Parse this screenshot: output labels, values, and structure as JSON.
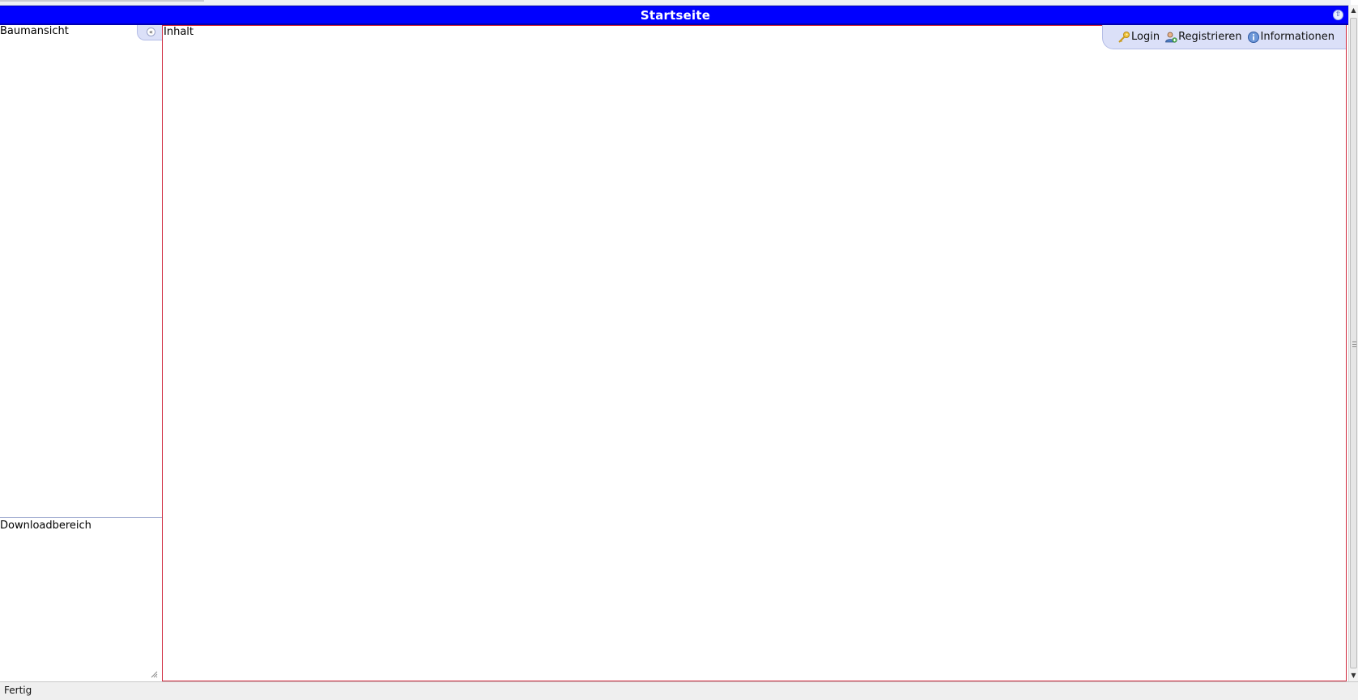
{
  "window": {
    "title": "Startseite"
  },
  "sidebar": {
    "tree_label": "Baumansicht",
    "download_label": "Downloadbereich"
  },
  "content": {
    "label": "Inhalt"
  },
  "toolbar": {
    "items": [
      {
        "label": "Login",
        "icon": "key-icon"
      },
      {
        "label": "Registrieren",
        "icon": "user-add-icon"
      },
      {
        "label": "Informationen",
        "icon": "info-icon"
      }
    ]
  },
  "status_bar": {
    "text": "Fertig"
  },
  "colors": {
    "title_bar": "#0000ff",
    "content_border": "#d0283c",
    "toolbar_bg": "#dbe0f8"
  }
}
